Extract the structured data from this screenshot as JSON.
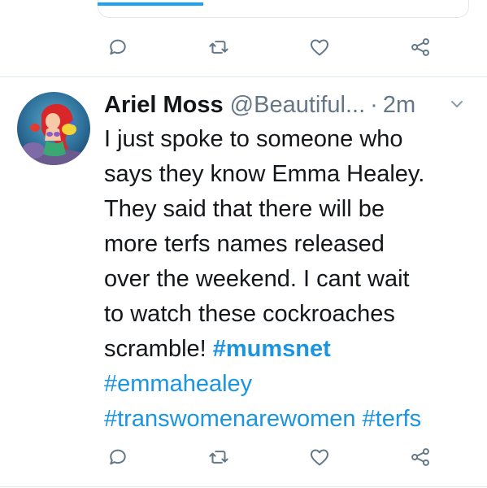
{
  "tweet": {
    "display_name": "Ariel Moss",
    "handle": "@Beautiful...",
    "separator": "·",
    "timestamp": "2m",
    "text_lines": [
      "I just spoke to someone who",
      "says they know Emma Healey.",
      "They said that there will be",
      "more terfs names released",
      "over the weekend. I cant wait",
      "to watch these cockroaches",
      "scramble! "
    ],
    "hashtags": [
      "#mumsnet",
      "#emmahealey",
      "#transwomenarewomen",
      "#terfs"
    ],
    "hashtag_color": "#1b95e0"
  },
  "icons": {
    "reply": "reply-icon",
    "retweet": "retweet-icon",
    "like": "heart-icon",
    "share": "share-icon",
    "caret": "chevron-down-icon"
  },
  "colors": {
    "accent": "#1da1f2",
    "secondary_text": "#657786",
    "icon": "#657786",
    "divider": "#e1e8ed"
  }
}
